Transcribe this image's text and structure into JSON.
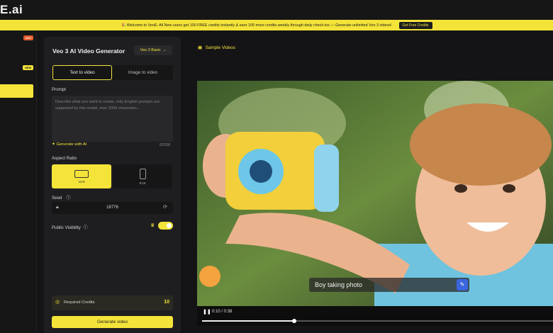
{
  "brand": {
    "logo_text": "E.ai"
  },
  "banner": {
    "message": "🎉 Welcome to VeoE: All New users get 100 FREE credits instantly & earn 100 more credits weekly through daily check-ins — Generate unlimited Veo 3 videos!",
    "cta_label": "Get Free Credits",
    "accent": "#f4e43a"
  },
  "nav": {
    "hot_badge": "HOT",
    "new_badge": "NEW"
  },
  "generator": {
    "title": "Veo 3 AI Video Generator",
    "model": "Veo 3 Basic",
    "tabs": [
      {
        "label": "Text to video",
        "active": true
      },
      {
        "label": "Image to video",
        "active": false
      }
    ],
    "prompt_label": "Prompt",
    "prompt_placeholder": "Describe what you want to create, only English prompts are supported by this model, max 2000 characters...",
    "generate_ai_label": "Generate with AI",
    "char_count": "0/2000",
    "aspect_label": "Aspect Ratio",
    "aspects": [
      {
        "label": "16:9",
        "active": true
      },
      {
        "label": "9:16",
        "active": false
      }
    ],
    "seed_label": "Seed",
    "seed_value": "18776",
    "visibility_label": "Public Visibility",
    "visibility_on": true,
    "credits_label": "Required Credits",
    "credits_value": "10",
    "generate_label": "Generate video"
  },
  "sample": {
    "title": "Sample Videos",
    "caption": "Boy taking photo",
    "time": "0:10 / 0:38",
    "progress": 0.263
  }
}
